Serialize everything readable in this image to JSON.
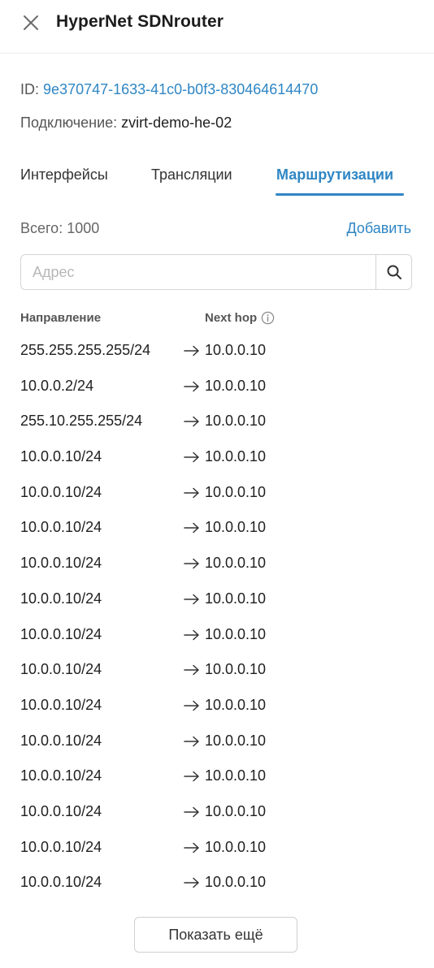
{
  "header": {
    "title": "HyperNet SDNrouter"
  },
  "meta": {
    "id_label": "ID:",
    "id_value": "9e370747-1633-41c0-b0f3-830464614470",
    "connection_label": "Подключение:",
    "connection_value": "zvirt-demo-he-02"
  },
  "tabs": [
    {
      "label": "Интерфейсы",
      "active": false
    },
    {
      "label": "Трансляции",
      "active": false
    },
    {
      "label": "Маршрутизации",
      "active": true
    }
  ],
  "toolbar": {
    "total_label": "Всего: 1000",
    "add_label": "Добавить"
  },
  "search": {
    "placeholder": "Адрес",
    "value": ""
  },
  "table": {
    "headers": {
      "direction": "Направление",
      "next_hop": "Next hop"
    },
    "rows": [
      {
        "direction": "255.255.255.255/24",
        "next_hop": "10.0.0.10"
      },
      {
        "direction": "10.0.0.2/24",
        "next_hop": "10.0.0.10"
      },
      {
        "direction": "255.10.255.255/24",
        "next_hop": "10.0.0.10"
      },
      {
        "direction": "10.0.0.10/24",
        "next_hop": "10.0.0.10"
      },
      {
        "direction": "10.0.0.10/24",
        "next_hop": "10.0.0.10"
      },
      {
        "direction": "10.0.0.10/24",
        "next_hop": "10.0.0.10"
      },
      {
        "direction": "10.0.0.10/24",
        "next_hop": "10.0.0.10"
      },
      {
        "direction": "10.0.0.10/24",
        "next_hop": "10.0.0.10"
      },
      {
        "direction": "10.0.0.10/24",
        "next_hop": "10.0.0.10"
      },
      {
        "direction": "10.0.0.10/24",
        "next_hop": "10.0.0.10"
      },
      {
        "direction": "10.0.0.10/24",
        "next_hop": "10.0.0.10"
      },
      {
        "direction": "10.0.0.10/24",
        "next_hop": "10.0.0.10"
      },
      {
        "direction": "10.0.0.10/24",
        "next_hop": "10.0.0.10"
      },
      {
        "direction": "10.0.0.10/24",
        "next_hop": "10.0.0.10"
      },
      {
        "direction": "10.0.0.10/24",
        "next_hop": "10.0.0.10"
      },
      {
        "direction": "10.0.0.10/24",
        "next_hop": "10.0.0.10"
      }
    ]
  },
  "footer": {
    "show_more_label": "Показать ещё"
  },
  "icons": {
    "close": "close-icon",
    "search": "search-icon",
    "info": "info-icon",
    "arrow": "arrow-right-icon"
  },
  "colors": {
    "accent": "#2f86c4",
    "text": "#1f1f1f",
    "muted": "#666666"
  }
}
